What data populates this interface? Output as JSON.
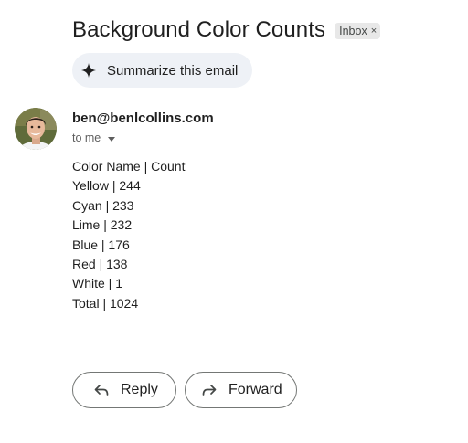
{
  "email": {
    "subject": "Background Color Counts",
    "label": "Inbox",
    "label_close": "×"
  },
  "summarize": {
    "label": "Summarize this email",
    "icon": "sparkle-icon"
  },
  "sender": {
    "email": "ben@benlcollins.com",
    "to_text": "to me"
  },
  "body": {
    "lines": [
      "Color Name | Count",
      "Yellow | 244",
      "Cyan | 233",
      "Lime | 232",
      "Blue | 176",
      "Red | 138",
      "White | 1",
      "Total | 1024"
    ]
  },
  "actions": {
    "reply_label": "Reply",
    "forward_label": "Forward"
  },
  "colors": {
    "chip_bg": "#e8e8e8",
    "summarize_bg": "#eef1f6",
    "text": "#1f1f1f",
    "muted": "#5e5e5e",
    "button_border": "#747775"
  }
}
